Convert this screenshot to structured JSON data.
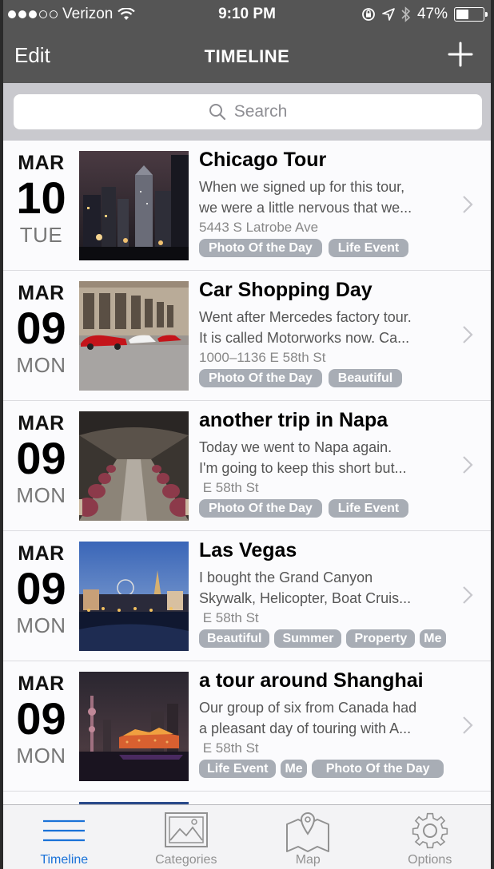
{
  "status": {
    "carrier": "Verizon",
    "time": "9:10 PM",
    "battery": "47%",
    "battery_level": 0.47,
    "signal_bars_filled": 3,
    "signal_bars_total": 5
  },
  "nav": {
    "edit_label": "Edit",
    "title": "TIMELINE",
    "add_icon": "plus-icon"
  },
  "search": {
    "placeholder": "Search"
  },
  "entries": [
    {
      "month": "MAR",
      "day": "10",
      "weekday": "TUE",
      "title": "Chicago Tour",
      "desc_line1": "When we signed up for this tour,",
      "desc_line2": "we were a little nervous that we...",
      "address": "5443 S Latrobe Ave",
      "tags": [
        "Photo Of the Day",
        "Life Event"
      ]
    },
    {
      "month": "MAR",
      "day": "09",
      "weekday": "MON",
      "title": "Car Shopping Day",
      "desc_line1": "Went after Mercedes factory tour.",
      "desc_line2": "It is called Motorworks now. Ca...",
      "address": "1000–1136 E 58th St",
      "tags": [
        "Photo Of the Day",
        "Beautiful"
      ]
    },
    {
      "month": "MAR",
      "day": "09",
      "weekday": "MON",
      "title": "another trip in Napa",
      "desc_line1": "Today we went to Napa again.",
      "desc_line2": "I'm going to keep this short but...",
      "address": " E 58th St",
      "tags": [
        "Photo Of the Day",
        "Life Event"
      ]
    },
    {
      "month": "MAR",
      "day": "09",
      "weekday": "MON",
      "title": "Las Vegas",
      "desc_line1": "I bought the Grand Canyon",
      "desc_line2": "Skywalk, Helicopter, Boat Cruis...",
      "address": " E 58th St",
      "tags": [
        "Beautiful",
        "Summer",
        "Property",
        "Me"
      ]
    },
    {
      "month": "MAR",
      "day": "09",
      "weekday": "MON",
      "title": "a tour around Shanghai",
      "desc_line1": "Our group of six from Canada had",
      "desc_line2": "a pleasant day of touring with A...",
      "address": " E 58th St",
      "tags": [
        "Life Event",
        "Me",
        "Photo Of the Day"
      ]
    }
  ],
  "tabs": {
    "timeline": "Timeline",
    "categories": "Categories",
    "map": "Map",
    "options": "Options",
    "active": "timeline"
  },
  "colors": {
    "navbar_bg": "#555555",
    "tag_bg": "#a8adb5",
    "active_tab": "#1a72d8"
  }
}
